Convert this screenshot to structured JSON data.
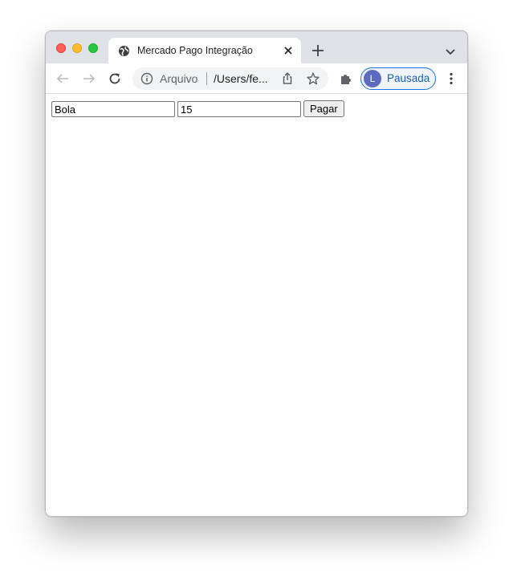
{
  "browser": {
    "tab": {
      "title": "Mercado Pago Integração",
      "favicon": "globe-icon"
    },
    "omnibox": {
      "scheme_label": "Arquivo",
      "url": "/Users/fe..."
    },
    "profile": {
      "initial": "L",
      "label": "Pausada",
      "accent": "#1a73e8"
    }
  },
  "form": {
    "product_value": "Bola",
    "price_value": "15",
    "submit_label": "Pagar"
  }
}
